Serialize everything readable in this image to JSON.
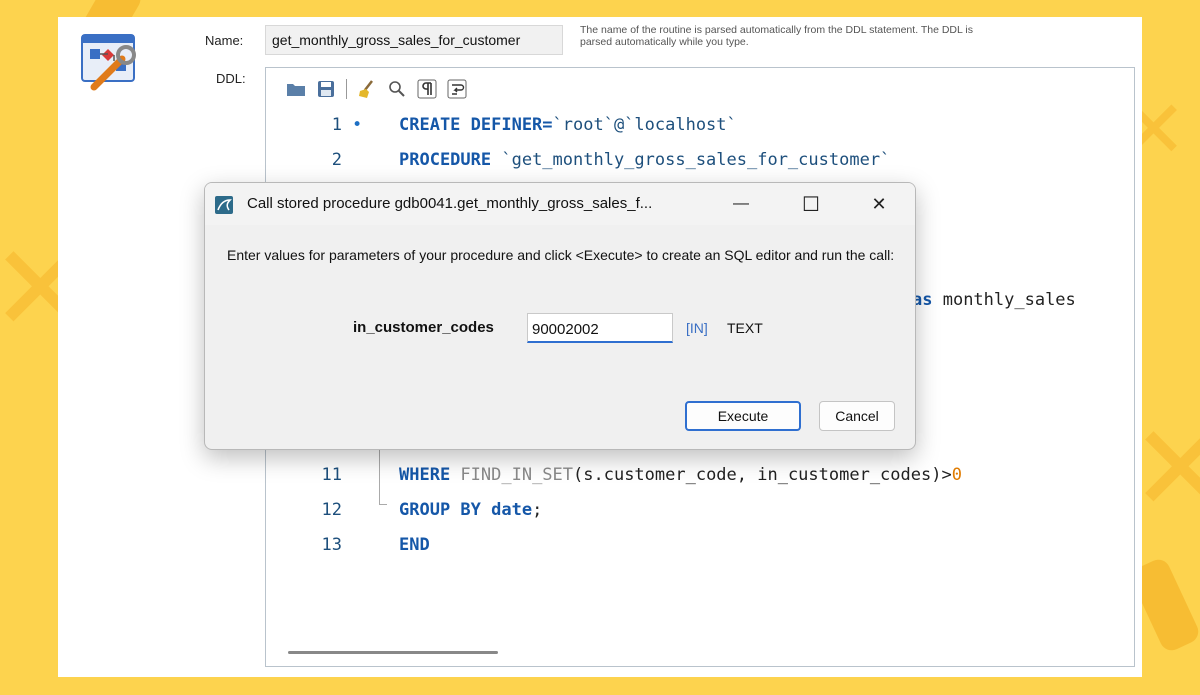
{
  "form": {
    "name_label": "Name:",
    "name_value": "get_monthly_gross_sales_for_customer",
    "name_hint": "The name of the routine is parsed automatically from the DDL statement. The DDL is parsed automatically while you type.",
    "ddl_label": "DDL:"
  },
  "toolbar": {
    "icons": [
      "folder-icon",
      "save-icon",
      "broom-icon",
      "search-icon",
      "pilcrow-icon",
      "wrap-icon"
    ]
  },
  "code_lines": [
    {
      "num": "1",
      "marker": "•",
      "parts": [
        {
          "t": "CREATE DEFINER=",
          "c": "kw"
        },
        {
          "t": "`root`@`localhost`",
          "c": "str"
        }
      ]
    },
    {
      "num": "2",
      "marker": "",
      "parts": [
        {
          "t": "PROCEDURE ",
          "c": "kw"
        },
        {
          "t": "`get_monthly_gross_sales_for_customer`",
          "c": "str"
        }
      ]
    },
    {
      "num": "",
      "marker": "",
      "parts": []
    },
    {
      "num": "",
      "marker": "",
      "parts": []
    },
    {
      "num": "",
      "marker": "",
      "parts": []
    },
    {
      "num": "",
      "marker": "",
      "parts": [
        {
          "t": "as",
          "c": "kw"
        },
        {
          "t": " monthly_sales",
          "c": ""
        }
      ]
    },
    {
      "num": "",
      "marker": "",
      "parts": []
    },
    {
      "num": "",
      "marker": "",
      "parts": []
    },
    {
      "num": "",
      "marker": "",
      "parts": []
    },
    {
      "num": "",
      "marker": "",
      "parts": []
    },
    {
      "num": "11",
      "marker": "",
      "parts": [
        {
          "t": "WHERE ",
          "c": "kw"
        },
        {
          "t": "FIND_IN_SET",
          "c": "fn"
        },
        {
          "t": "(s.customer_code, in_customer_codes)>",
          "c": ""
        },
        {
          "t": "0",
          "c": "num"
        }
      ]
    },
    {
      "num": "12",
      "marker": "",
      "parts": [
        {
          "t": "GROUP BY ",
          "c": "kw"
        },
        {
          "t": "date",
          "c": "kw"
        },
        {
          "t": ";",
          "c": ""
        }
      ]
    },
    {
      "num": "13",
      "marker": "",
      "parts": [
        {
          "t": "END",
          "c": "kw"
        }
      ]
    }
  ],
  "dialog": {
    "title": "Call stored procedure gdb0041.get_monthly_gross_sales_f...",
    "message": "Enter values for parameters of your procedure and click <Execute> to create an SQL editor and run the call:",
    "param_label": "in_customer_codes",
    "param_value": "90002002",
    "param_direction": "[IN]",
    "param_type": "TEXT",
    "execute_label": "Execute",
    "cancel_label": "Cancel",
    "minimize_glyph": "—",
    "maximize_glyph": "☐",
    "close_glyph": "✕"
  },
  "colors": {
    "background": "#fdd34e",
    "keyword": "#1557a8",
    "accent": "#2f6fd0"
  }
}
